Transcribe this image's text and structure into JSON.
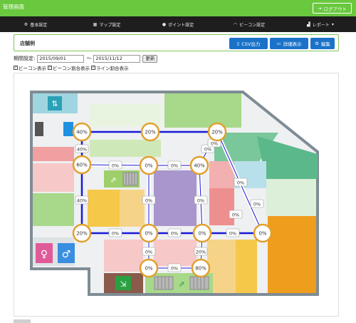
{
  "header": {
    "app_title": "管理画面",
    "logout_label": "ログアウト"
  },
  "nav": [
    {
      "label": "基本設定",
      "icon": "gear-icon"
    },
    {
      "label": "マップ設定",
      "icon": "map-icon"
    },
    {
      "label": "ポイント設定",
      "icon": "pin-icon"
    },
    {
      "label": "ビーコン設定",
      "icon": "wifi-icon"
    },
    {
      "label": "レポート",
      "icon": "chart-icon"
    }
  ],
  "panel": {
    "title": "店舗例",
    "csv_label": "CSV出力",
    "detail_label": "詳細表示",
    "edit_label": "編集"
  },
  "filters": {
    "period_label": "期間設定:",
    "start_date": "2015/09/01",
    "separator": "〜",
    "end_date": "2015/11/12",
    "update_label": "更新",
    "checkboxes": [
      {
        "label": "ビーコン表示",
        "checked": true
      },
      {
        "label": "ビーコン割合表示",
        "checked": true
      },
      {
        "label": "ライン割合表示",
        "checked": true
      }
    ]
  },
  "map": {
    "beacons": [
      "40%",
      "20%",
      "20%",
      "40%",
      "60%",
      "0%",
      "0%",
      "40%",
      "20%",
      "0%",
      "0%",
      "0%",
      "0%",
      "80%"
    ],
    "lines": [
      "20%",
      "40%",
      "0%",
      "0%",
      "0%",
      "0%",
      "40%",
      "0%",
      "0%",
      "0%",
      "0%",
      "20%",
      "0%",
      "0%",
      "0%",
      "0%",
      "0%",
      "0%",
      "0%"
    ],
    "colors": {
      "accent": "#6ac83f",
      "line": "#1a1ad6",
      "beacon_ring": "#e0a030"
    }
  }
}
